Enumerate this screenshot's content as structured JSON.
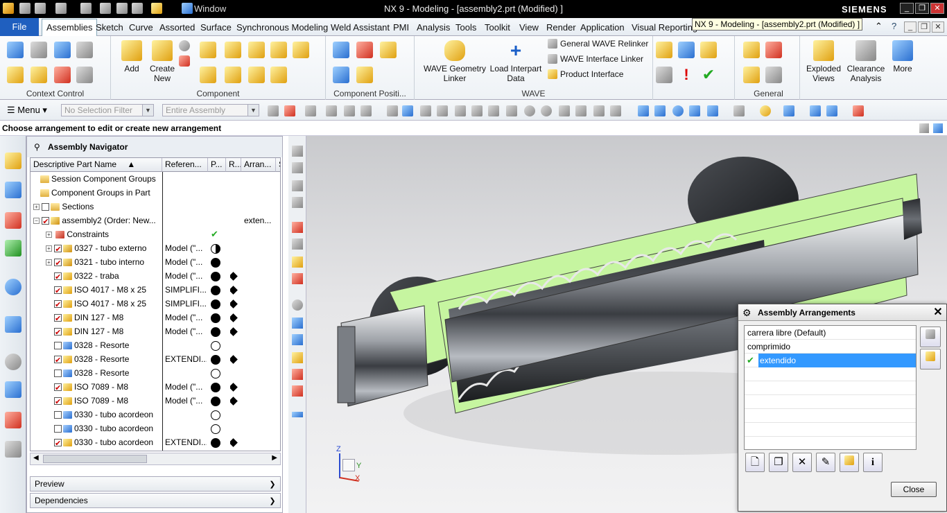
{
  "window": {
    "title": "NX 9 - Modeling - [assembly2.prt (Modified) ]",
    "brand": "SIEMENS",
    "window_menu": "Window"
  },
  "tooltip": "NX 9 - Modeling - [assembly2.prt (Modified) ]",
  "menu_tabs": [
    "File",
    "Assemblies",
    "Sketch",
    "Curve",
    "Assorted",
    "Surface",
    "Synchronous Modeling",
    "Weld Assistant",
    "PMI",
    "Analysis",
    "Tools",
    "Toolkit",
    "View",
    "Render",
    "Application",
    "Visual Reporting"
  ],
  "ribbon": {
    "groups": {
      "context_control": "Context Control",
      "component": "Component",
      "component_position": "Component Positi...",
      "wave": "WAVE",
      "general": "General"
    },
    "buttons": {
      "add": "Add",
      "create_new": "Create New",
      "wave_geometry_linker": "WAVE Geometry Linker",
      "load_interpart_data": "Load Interpart Data",
      "general_wave_relinker": "General WAVE Relinker",
      "wave_interface_linker": "WAVE Interface Linker",
      "product_interface": "Product Interface",
      "exploded_views": "Exploded Views",
      "clearance_analysis": "Clearance Analysis",
      "more": "More"
    }
  },
  "toolbar": {
    "menu": "Menu",
    "selection_filter": "No Selection Filter",
    "assembly_scope": "Entire Assembly"
  },
  "cue_line": "Choose arrangement to edit or create new arrangement",
  "navigator": {
    "title": "Assembly Navigator",
    "columns": [
      "Descriptive Part Name",
      "Referen...",
      "P...",
      "R...",
      "Arran...",
      "S"
    ],
    "rows": [
      {
        "name": "Session Component Groups",
        "ref": "",
        "arr": ""
      },
      {
        "name": "Component Groups in Part",
        "ref": "",
        "arr": ""
      },
      {
        "name": "Sections",
        "ref": "",
        "arr": ""
      },
      {
        "name": "assembly2 (Order: New...",
        "ref": "",
        "arr": "exten..."
      },
      {
        "name": "Constraints",
        "ref": "",
        "arr": ""
      },
      {
        "name": "0327 - tubo externo",
        "ref": "Model (\"...",
        "arr": ""
      },
      {
        "name": "0321 - tubo interno",
        "ref": "Model (\"...",
        "arr": ""
      },
      {
        "name": "0322 - traba",
        "ref": "Model (\"...",
        "arr": ""
      },
      {
        "name": "ISO 4017 - M8 x 25",
        "ref": "SIMPLIFI...",
        "arr": ""
      },
      {
        "name": "ISO 4017 - M8 x 25",
        "ref": "SIMPLIFI...",
        "arr": ""
      },
      {
        "name": "DIN 127 - M8",
        "ref": "Model (\"...",
        "arr": ""
      },
      {
        "name": "DIN 127 - M8",
        "ref": "Model (\"...",
        "arr": ""
      },
      {
        "name": "0328 - Resorte",
        "ref": "",
        "arr": ""
      },
      {
        "name": "0328 - Resorte",
        "ref": "EXTENDI...",
        "arr": ""
      },
      {
        "name": "0328 - Resorte",
        "ref": "",
        "arr": ""
      },
      {
        "name": "ISO 7089 - M8",
        "ref": "Model (\"...",
        "arr": ""
      },
      {
        "name": "ISO 7089 - M8",
        "ref": "Model (\"...",
        "arr": ""
      },
      {
        "name": "0330 - tubo acordeon",
        "ref": "",
        "arr": ""
      },
      {
        "name": "0330 - tubo acordeon",
        "ref": "",
        "arr": ""
      },
      {
        "name": "0330 - tubo acordeon",
        "ref": "EXTENDI...",
        "arr": ""
      }
    ],
    "preview": "Preview",
    "dependencies": "Dependencies"
  },
  "dialog": {
    "title": "Assembly Arrangements",
    "arrangements": [
      "carrera libre (Default)",
      "comprimido",
      "extendido"
    ],
    "selected": "extendido",
    "close": "Close"
  },
  "triad": {
    "z": "Z",
    "y": "Y",
    "x": "X"
  }
}
